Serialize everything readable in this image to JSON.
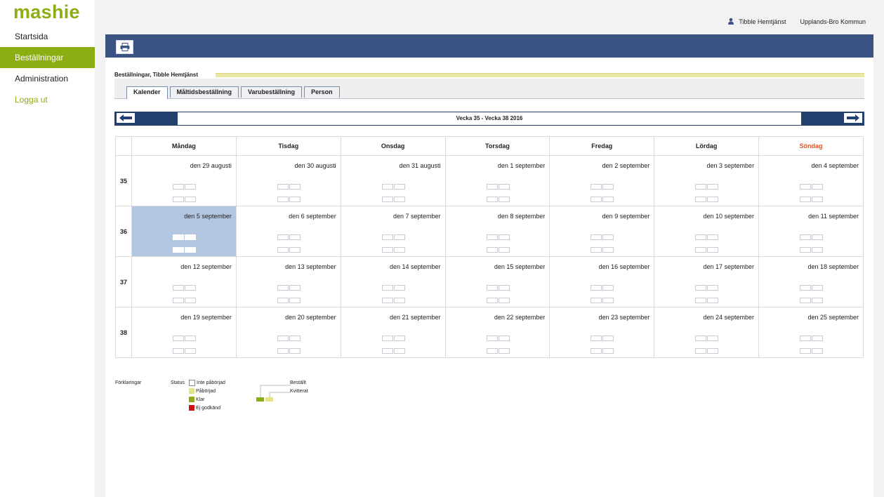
{
  "app": {
    "logo": "mashie"
  },
  "sidebar": {
    "items": [
      {
        "label": "Startsida",
        "active": false
      },
      {
        "label": "Beställningar",
        "active": true
      },
      {
        "label": "Administration",
        "active": false
      },
      {
        "label": "Logga ut",
        "active": false
      }
    ]
  },
  "header": {
    "user_name": "Tibble Hemtjänst",
    "organization": "Upplands-Bro Kommun",
    "user_icon": "user-icon"
  },
  "toolbar": {
    "print_icon": "printer-icon"
  },
  "section": {
    "title": "Beställningar, Tibble Hemtjänst"
  },
  "tabs": [
    {
      "label": "Kalender",
      "active": true
    },
    {
      "label": "Måltidsbeställning",
      "active": false
    },
    {
      "label": "Varubeställning",
      "active": false
    },
    {
      "label": "Person",
      "active": false
    }
  ],
  "week_nav": {
    "label": "Vecka 35 - Vecka 38 2016",
    "prev_icon": "arrow-left-icon",
    "next_icon": "arrow-right-icon"
  },
  "calendar": {
    "days": [
      "Måndag",
      "Tisdag",
      "Onsdag",
      "Torsdag",
      "Fredag",
      "Lördag",
      "Söndag"
    ],
    "weeks": [
      {
        "number": "35",
        "dates": [
          "den 29 augusti",
          "den 30 augusti",
          "den 31 augusti",
          "den 1 september",
          "den 2 september",
          "den 3 september",
          "den 4 september"
        ]
      },
      {
        "number": "36",
        "dates": [
          "den 5 september",
          "den 6 september",
          "den 7 september",
          "den 8 september",
          "den 9 september",
          "den 10 september",
          "den 11 september"
        ]
      },
      {
        "number": "37",
        "dates": [
          "den 12 september",
          "den 13 september",
          "den 14 september",
          "den 15 september",
          "den 16 september",
          "den 17 september",
          "den 18 september"
        ]
      },
      {
        "number": "38",
        "dates": [
          "den 19 september",
          "den 20 september",
          "den 21 september",
          "den 22 september",
          "den 23 september",
          "den 24 september",
          "den 25 september"
        ]
      }
    ],
    "selected_date": "den 5 september"
  },
  "legend": {
    "title": "Förklaringar",
    "status_label": "Status",
    "items": [
      {
        "label": "Inte påbörjad",
        "color": "#ffffff"
      },
      {
        "label": "Påbörjad",
        "color": "#e4e38a"
      },
      {
        "label": "Klar",
        "color": "#8cae14"
      },
      {
        "label": "Ej godkänd",
        "color": "#cc1111"
      }
    ],
    "diagram": {
      "ordered_label": "Beställt",
      "confirmed_label": "Kvitterat"
    }
  },
  "colors": {
    "brand": "#8cae14",
    "toolbar": "#3b5382",
    "selected_cell": "#b3c6df",
    "sunday": "#e8531f"
  }
}
